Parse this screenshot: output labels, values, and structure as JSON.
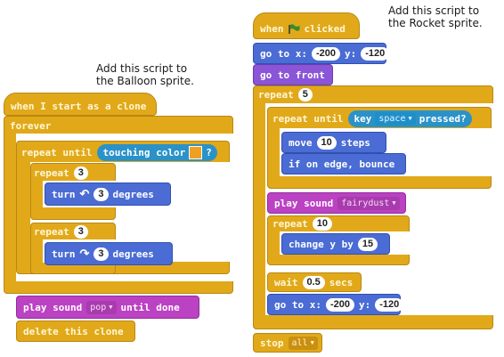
{
  "notes": {
    "balloon": "Add this script to\nthe Balloon sprite.",
    "rocket": "Add this script to\nthe Rocket sprite."
  },
  "balloon_script": {
    "hat": "when I start as a clone",
    "forever": "forever",
    "repeat_until": "repeat until",
    "touching_color": "touching color",
    "question": "?",
    "repeat1": {
      "label": "repeat",
      "count": "3"
    },
    "turn_left": {
      "label": "turn",
      "value": "3",
      "suffix": "degrees"
    },
    "repeat2": {
      "label": "repeat",
      "count": "3"
    },
    "turn_right": {
      "label": "turn",
      "value": "3",
      "suffix": "degrees"
    },
    "play_sound": {
      "label": "play sound",
      "sound": "pop",
      "suffix": "until done"
    },
    "delete_clone": "delete this clone"
  },
  "rocket_script": {
    "hat": {
      "when": "when",
      "clicked": "clicked"
    },
    "goto1": {
      "label": "go to x:",
      "x": "-200",
      "ylabel": "y:",
      "y": "-120"
    },
    "goto_front": "go to front",
    "repeat": {
      "label": "repeat",
      "count": "5"
    },
    "repeat_until": {
      "label": "repeat until",
      "key": "key",
      "key_name": "space",
      "pressed": "pressed?"
    },
    "move": {
      "label": "move",
      "value": "10",
      "suffix": "steps"
    },
    "bounce": "if on edge, bounce",
    "play_sound": {
      "label": "play sound",
      "sound": "fairydust"
    },
    "repeat10": {
      "label": "repeat",
      "count": "10"
    },
    "change_y": {
      "label": "change y by",
      "value": "15"
    },
    "wait": {
      "label": "wait",
      "value": "0.5",
      "suffix": "secs"
    },
    "goto2": {
      "label": "go to x:",
      "x": "-200",
      "ylabel": "y:",
      "y": "-120"
    },
    "stop": {
      "label": "stop",
      "option": "all"
    }
  },
  "colors": {
    "control": "#e1a91a",
    "motion": "#4a6cd4",
    "looks": "#8a55d7",
    "sound": "#bb42c3",
    "sensing": "#2ca5e2"
  }
}
